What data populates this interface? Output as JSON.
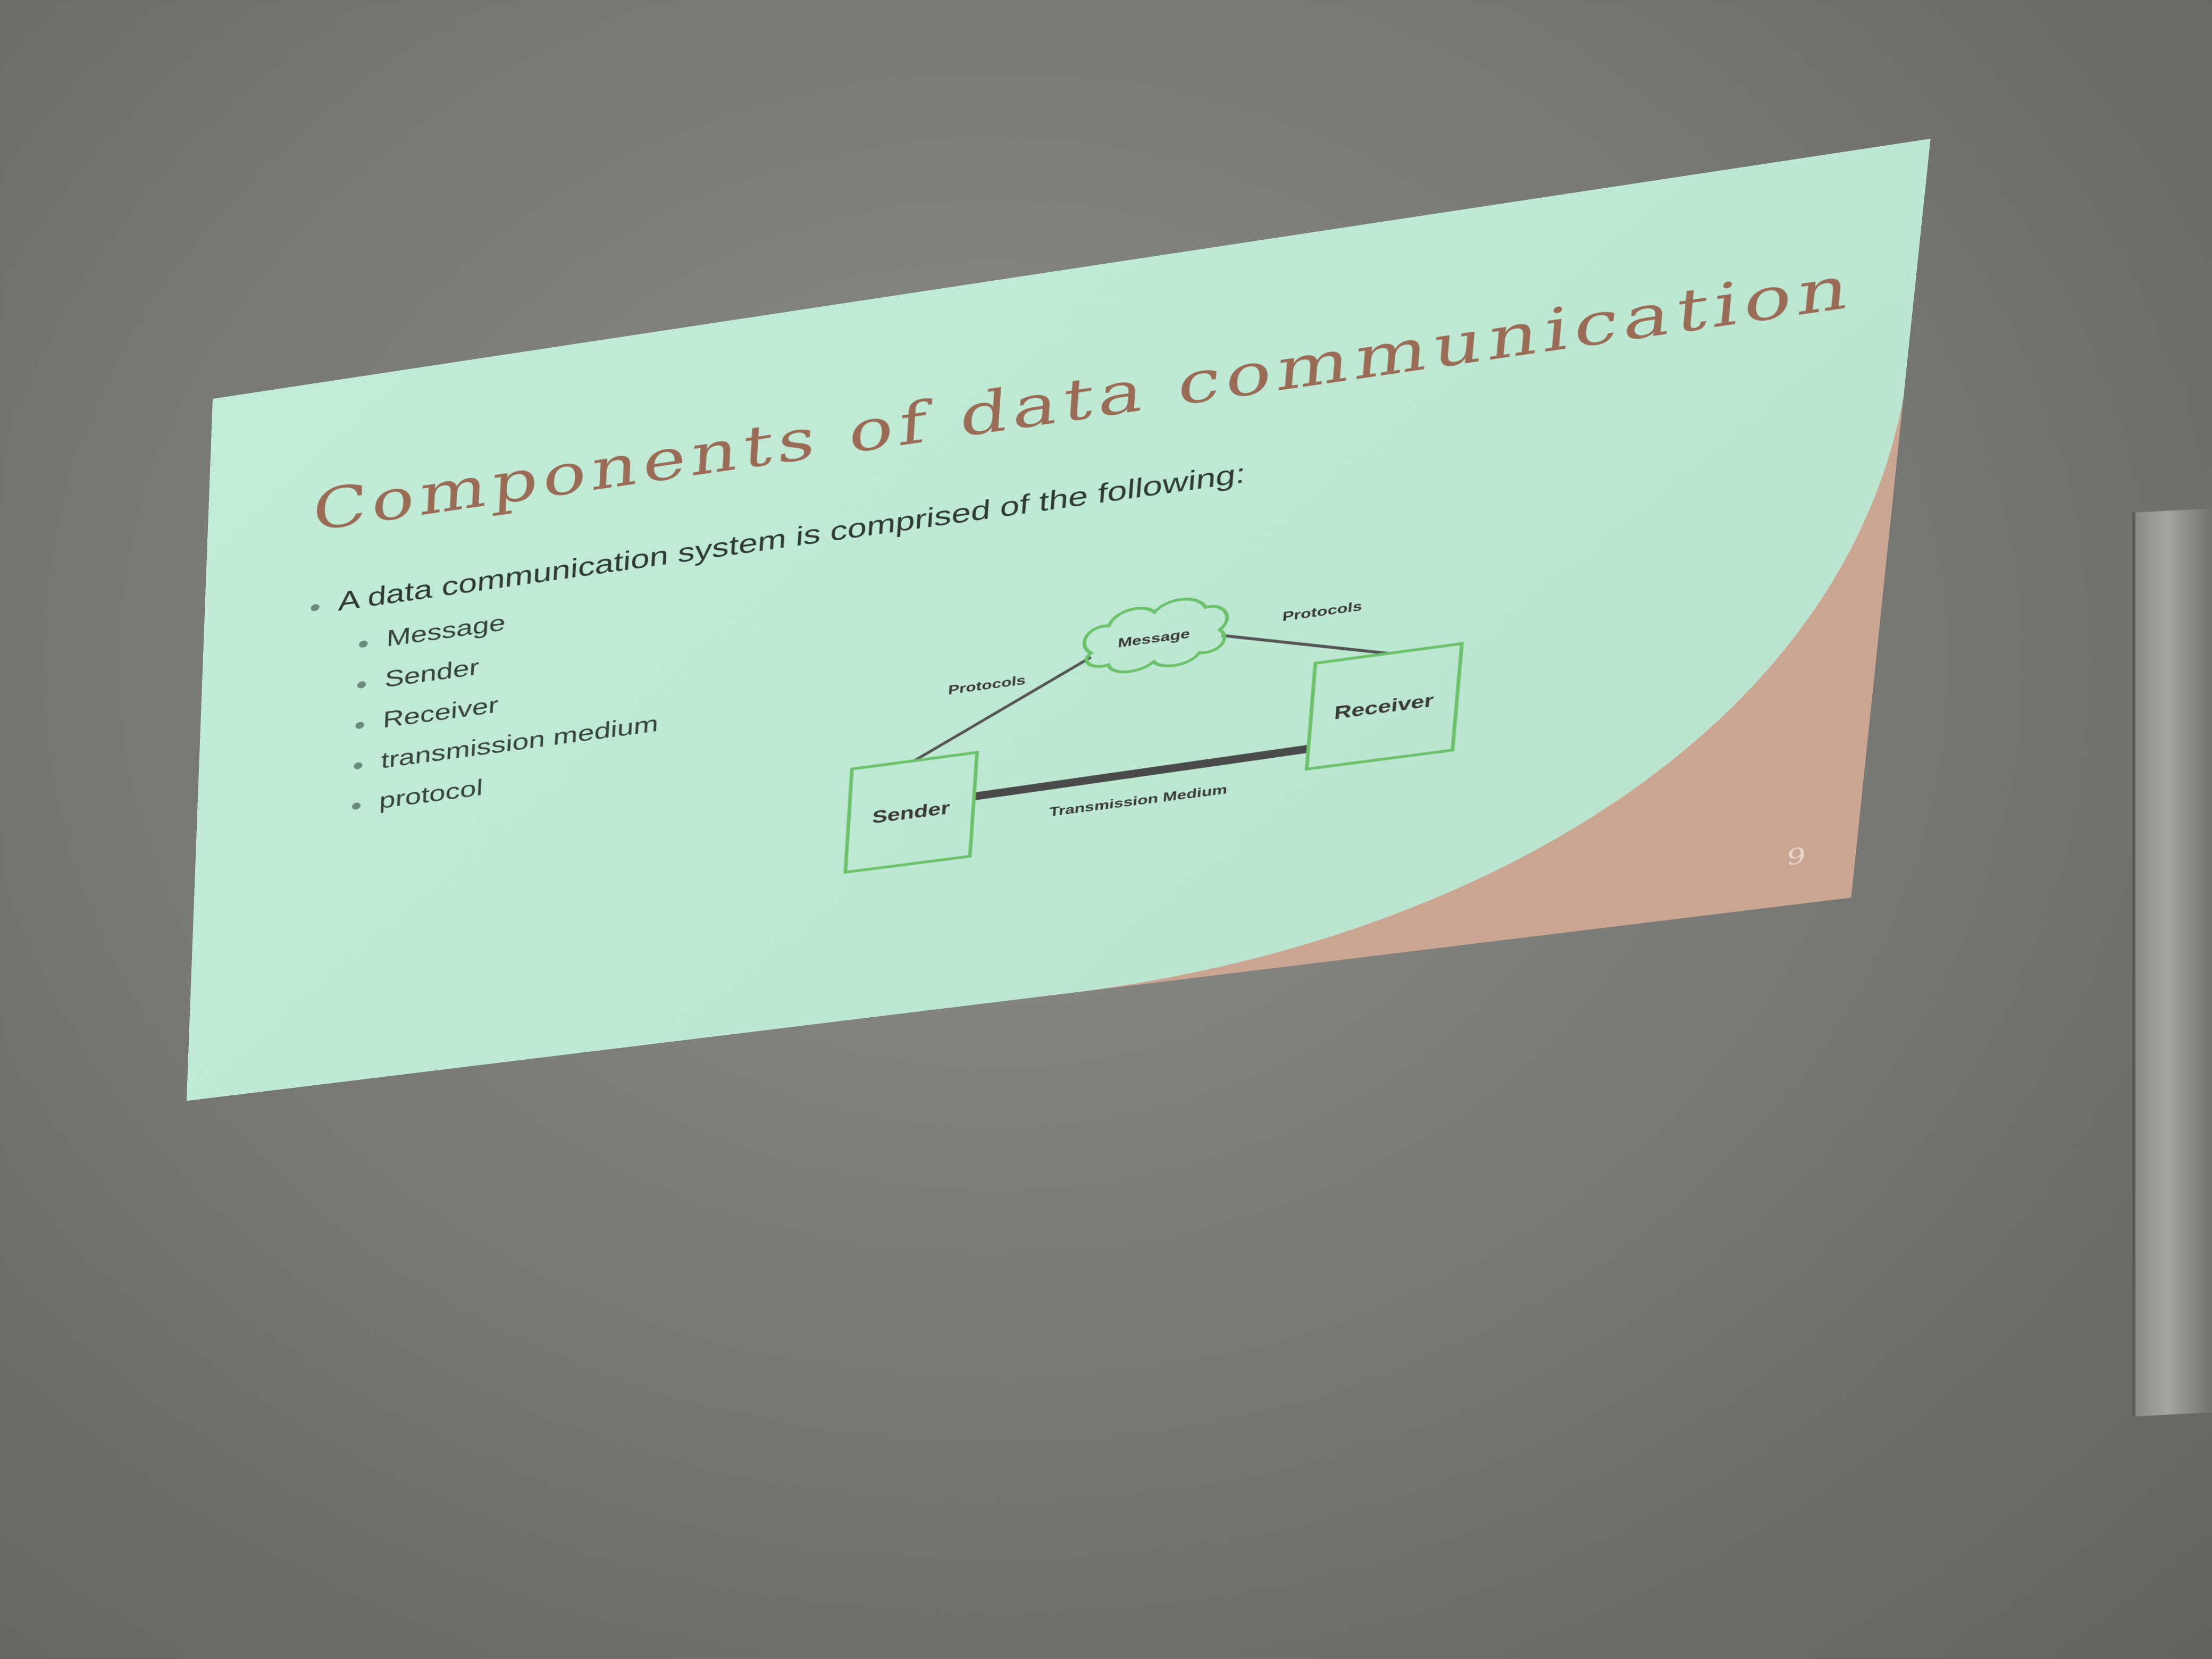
{
  "slide": {
    "title": "Components of data communication",
    "intro": "A data communication system is comprised of the following:",
    "items": [
      "Message",
      "Sender",
      "Receiver",
      "transmission medium",
      "protocol"
    ],
    "page_number": "9"
  },
  "diagram": {
    "sender": "Sender",
    "receiver": "Receiver",
    "message": "Message",
    "protocols_left": "Protocols",
    "protocols_right": "Protocols",
    "medium": "Transmission Medium"
  },
  "colors": {
    "slide_bg": "#c2ecd7",
    "accent": "#c9a592",
    "title": "#9a6b55",
    "box_border": "#6cc26a"
  }
}
